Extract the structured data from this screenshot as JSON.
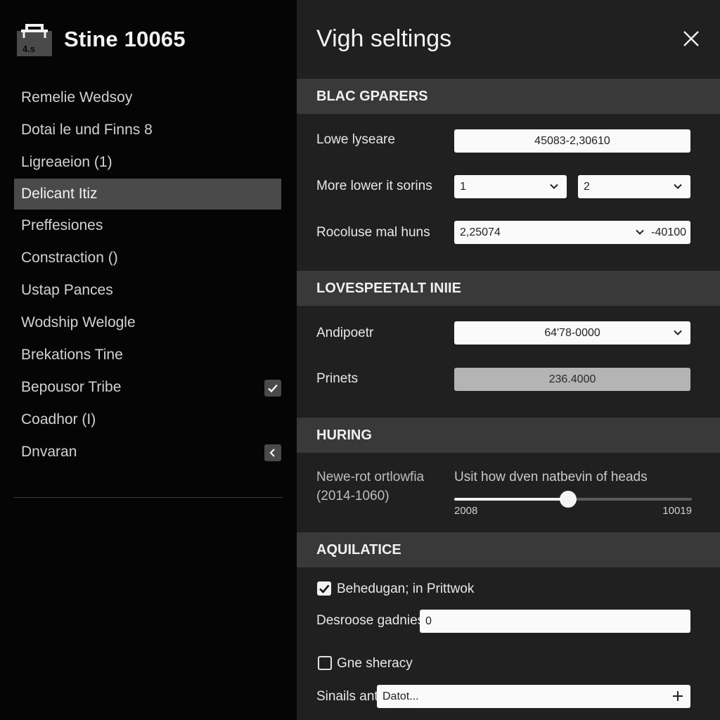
{
  "sidebar": {
    "app_title": "Stine 10065",
    "logo_text": "4.s",
    "items": [
      {
        "label": "Remelie Wedsoy"
      },
      {
        "label": "Dotai le und Finns 8"
      },
      {
        "label": "Ligreaeion (1)"
      },
      {
        "label": "Delicant Itiz",
        "active": true
      },
      {
        "label": "Preffesiones"
      },
      {
        "label": "Constraction  ()"
      },
      {
        "label": "Ustap Pances"
      },
      {
        "label": "Wodship Welogle"
      },
      {
        "label": "Brekations Tine"
      },
      {
        "label": "Bepousor Tribe",
        "icon": "check-icon"
      },
      {
        "label": "Coadhor (I)"
      },
      {
        "label": "Dnvaran",
        "icon": "chevron-left-icon"
      }
    ]
  },
  "panel": {
    "title": "Vigh seltings",
    "close_icon": "close-icon",
    "sections": {
      "s1": {
        "heading": "BLAC GPARERS",
        "row1": {
          "label": "Lowe lyseare",
          "value": "45083-2,30610"
        },
        "row2": {
          "label": "More lower it sorins",
          "select_a": "1",
          "select_b": "2"
        },
        "row3": {
          "label": "Rocoluse mal huns",
          "value": "2,25074",
          "suffix": "-40100"
        }
      },
      "s2": {
        "heading": "LOVESPEETALT INIIE",
        "row1": {
          "label": "Andipoetr",
          "value": "64'78-0000"
        },
        "row2": {
          "label": "Prinets",
          "value": "236.4000"
        }
      },
      "s3": {
        "heading": "HURING",
        "label_line1": "Newe-rot ortlowfia",
        "label_line2": "(2014-1060)",
        "slider_caption": "Usit how dven natbevin of heads",
        "slider_min": "2008",
        "slider_max": "10019",
        "slider_fraction": 0.48
      },
      "s4": {
        "heading": "AQUILATICE",
        "check1": {
          "label": "Behedugan; in Prittwok",
          "checked": true
        },
        "row1": {
          "label": "Desroose gadnies",
          "value": "0"
        },
        "check2": {
          "label": "Gne sheracy",
          "checked": false
        },
        "row2": {
          "label": "Sinails ant",
          "value": "Datot...",
          "icon": "plus-icon"
        }
      }
    }
  },
  "colors": {
    "sidebar_bg": "#050505",
    "panel_bg": "#202020",
    "section_bg": "#393939",
    "active_item_bg": "#4a4a4a"
  }
}
